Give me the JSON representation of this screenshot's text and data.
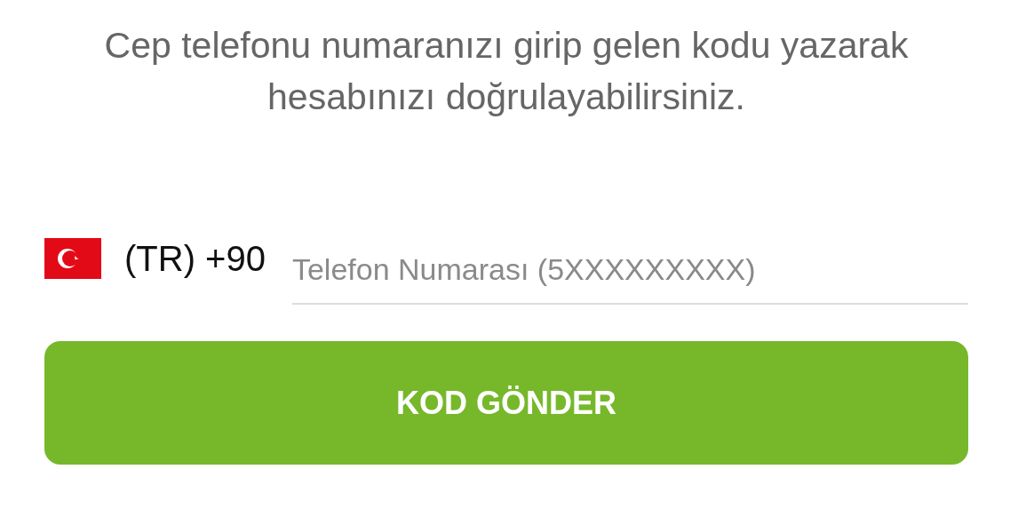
{
  "instruction": "Cep telefonu numaranızı girip gelen kodu yazarak hesabınızı doğrulayabilirsiniz.",
  "phone": {
    "country_code": "(TR) +90",
    "placeholder": "Telefon Numarası (5XXXXXXXXX)"
  },
  "button": {
    "label": "KOD GÖNDER"
  }
}
